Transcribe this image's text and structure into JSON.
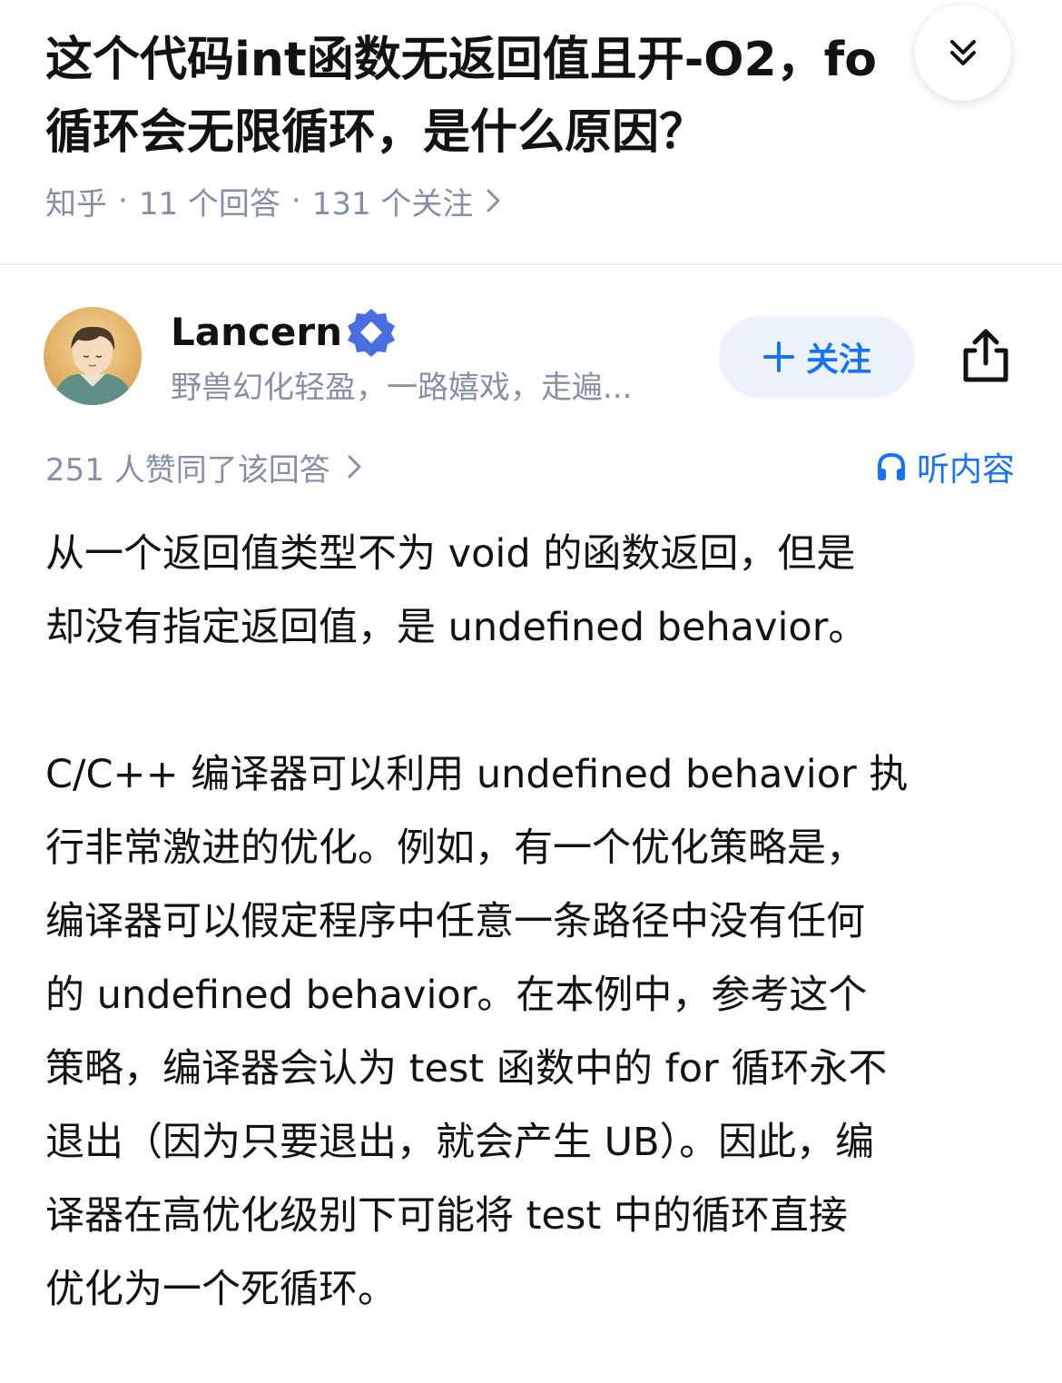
{
  "question": {
    "title_line1": "这个代码int函数无返回值且开-O2，fo",
    "title_line2": "循环会无限循环，是什么原因？",
    "site": "知乎",
    "answers": "11 个回答",
    "followers": "131 个关注"
  },
  "icons": {
    "collapse": "double-chevron-down-icon",
    "meta_chevron": "chevron-right-icon",
    "verify": "verified-badge-icon",
    "share": "share-icon",
    "headphones": "headphones-icon"
  },
  "author": {
    "name": "Lancern",
    "bio": "野兽幻化轻盈，一路嬉戏，走遍...",
    "follow_label": "关注"
  },
  "vote": {
    "text": "251 人赞同了该回答"
  },
  "listen": {
    "label": "听内容"
  },
  "answer": {
    "lines": [
      "从一个返回值类型不为 void 的函数返回，但是",
      "却没有指定返回值，是 undefined behavior。",
      "",
      "C/C++ 编译器可以利用 undefined behavior 执",
      "行非常激进的优化。例如，有一个优化策略是，",
      "编译器可以假定程序中任意一条路径中没有任何",
      "的 undefined behavior。在本例中，参考这个",
      "策略，编译器会认为 test 函数中的 for 循环永不",
      "退出（因为只要退出，就会产生 UB）。因此，编",
      "译器在高优化级别下可能将 test 中的循环直接",
      "优化为一个死循环。"
    ]
  },
  "colors": {
    "primary_text": "#121212",
    "secondary_text": "#8590a6",
    "accent_blue": "#1772f6",
    "follow_bg": "#ebf2fd"
  }
}
